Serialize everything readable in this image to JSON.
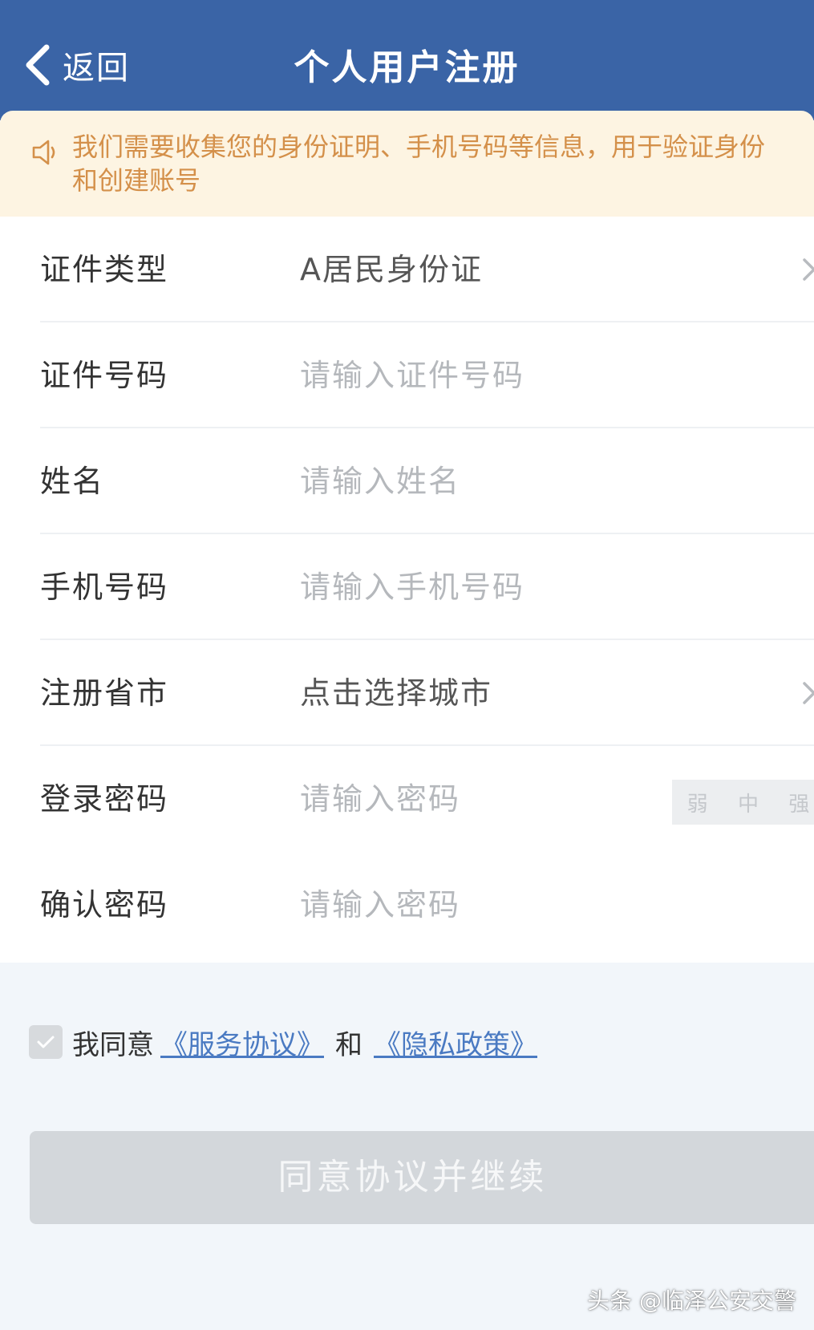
{
  "header": {
    "back_label": "返回",
    "title": "个人用户注册"
  },
  "notice": {
    "icon": "speaker-icon",
    "text_line1": "我们需要收集您的身份证明、手机号码等信息，用于验证身份",
    "text_line2": "和创建账号"
  },
  "form": {
    "rows": [
      {
        "label": "证件类型",
        "value": "A居民身份证",
        "type": "select"
      },
      {
        "label": "证件号码",
        "placeholder": "请输入证件号码",
        "type": "input"
      },
      {
        "label": "姓名",
        "placeholder": "请输入姓名",
        "type": "input"
      },
      {
        "label": "手机号码",
        "placeholder": "请输入手机号码",
        "type": "input"
      },
      {
        "label": "注册省市",
        "value": "点击选择城市",
        "type": "select"
      },
      {
        "label": "登录密码",
        "placeholder": "请输入密码",
        "type": "password"
      },
      {
        "label": "确认密码",
        "placeholder": "请输入密码",
        "type": "password"
      }
    ],
    "strength": [
      "弱",
      "中",
      "强"
    ]
  },
  "agreement": {
    "prefix": "我同意",
    "service_link": "《服务协议》",
    "and": "和",
    "privacy_link": "《隐私政策》"
  },
  "submit_label": "同意协议并继续",
  "watermark": "头条 @临泽公安交警",
  "colors": {
    "header_bg": "#3a64a6",
    "notice_bg": "#fdf4e2",
    "notice_text": "#d4904a",
    "link": "#4a7ac2",
    "button_bg": "#d3d7db"
  }
}
